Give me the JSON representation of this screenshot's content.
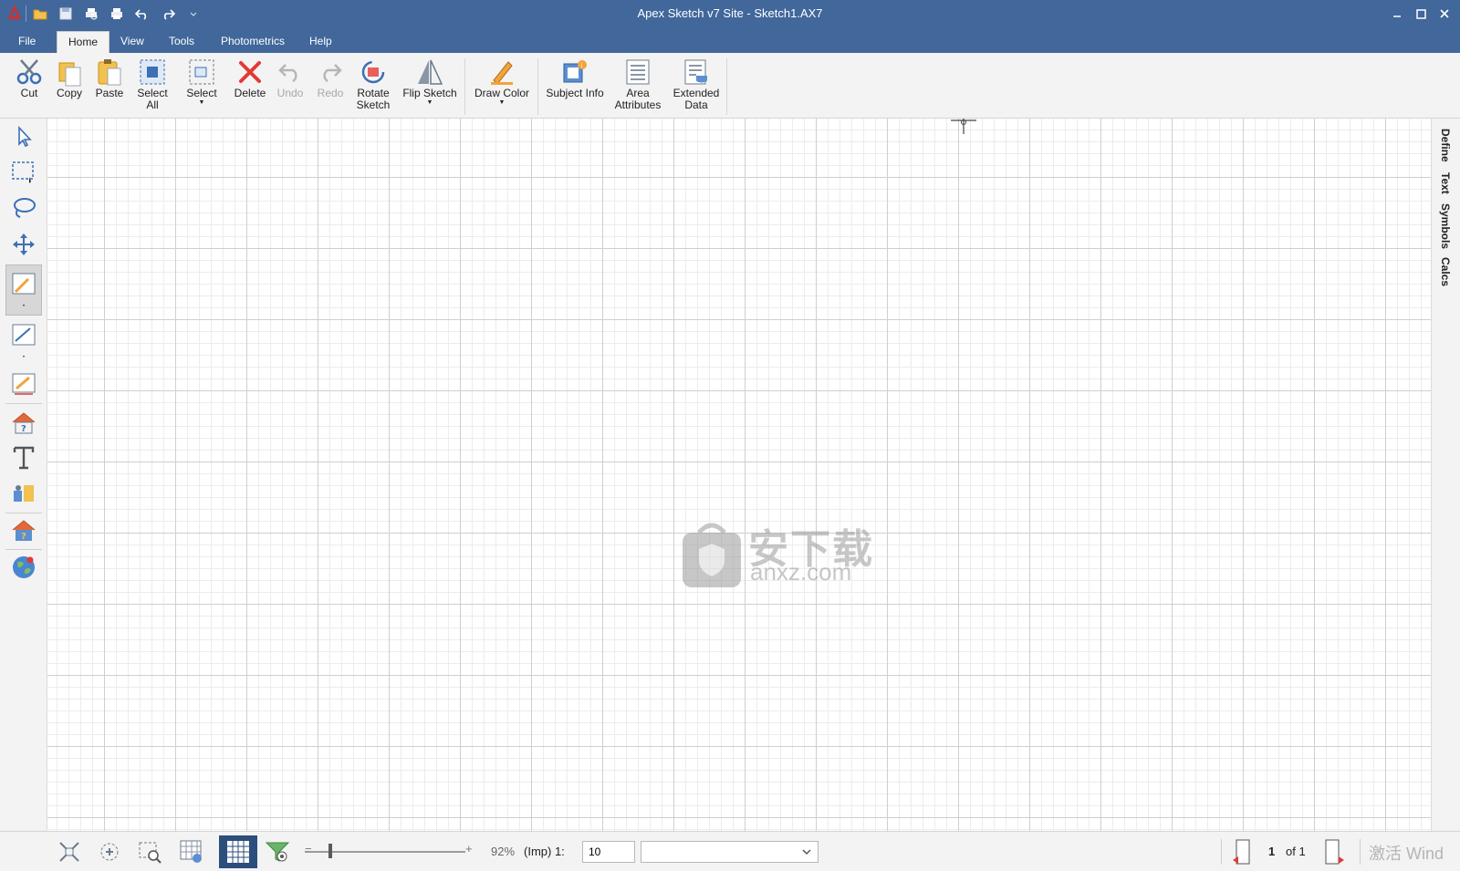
{
  "window": {
    "title": "Apex Sketch v7 Site - Sketch1.AX7",
    "controls": [
      "minimize",
      "maximize",
      "close"
    ]
  },
  "quick_access": [
    "open-icon",
    "save-icon",
    "print-preview-icon",
    "print-icon",
    "undo-icon",
    "redo-icon",
    "customize-icon"
  ],
  "menu": {
    "tabs": [
      {
        "label": "File",
        "active": false
      },
      {
        "label": "Home",
        "active": true
      },
      {
        "label": "View",
        "active": false
      },
      {
        "label": "Tools",
        "active": false
      },
      {
        "label": "Photometrics",
        "active": false
      },
      {
        "label": "Help",
        "active": false
      }
    ]
  },
  "ribbon": {
    "cut": "Cut",
    "copy": "Copy",
    "paste": "Paste",
    "select_all_1": "Select",
    "select_all_2": "All",
    "select": "Select",
    "delete": "Delete",
    "undo": "Undo",
    "redo": "Redo",
    "rotate_1": "Rotate",
    "rotate_2": "Sketch",
    "flip": "Flip Sketch",
    "draw_color": "Draw Color",
    "subject_info": "Subject Info",
    "area_1": "Area",
    "area_2": "Attributes",
    "ext_1": "Extended",
    "ext_2": "Data"
  },
  "left_tools": [
    "select-arrow-icon",
    "rectangle-select-icon",
    "lasso-select-icon",
    "move-icon",
    "draw-area-icon",
    "draw-line-icon",
    "draw-dimension-icon",
    "house-area-icon",
    "text-tool-icon",
    "symbols-tool-icon",
    "house-info-icon",
    "globe-icon"
  ],
  "right_dock": {
    "tabs": [
      "Define",
      "Text",
      "Symbols",
      "Calcs"
    ]
  },
  "watermark": {
    "cn": "安下载",
    "en": "anxz.com"
  },
  "status": {
    "zoom": "92%",
    "scale_label": "(Imp) 1:",
    "scale_value": "10",
    "dropdown_value": "",
    "page_current": "1",
    "page_total_label": "of 1",
    "watermark_text": "激活 Wind"
  },
  "colors": {
    "titlebar": "#41679b",
    "ribbon_bg": "#f3f3f3",
    "accent_red": "#e53935",
    "active_status_icon": "#2c4e7c"
  }
}
